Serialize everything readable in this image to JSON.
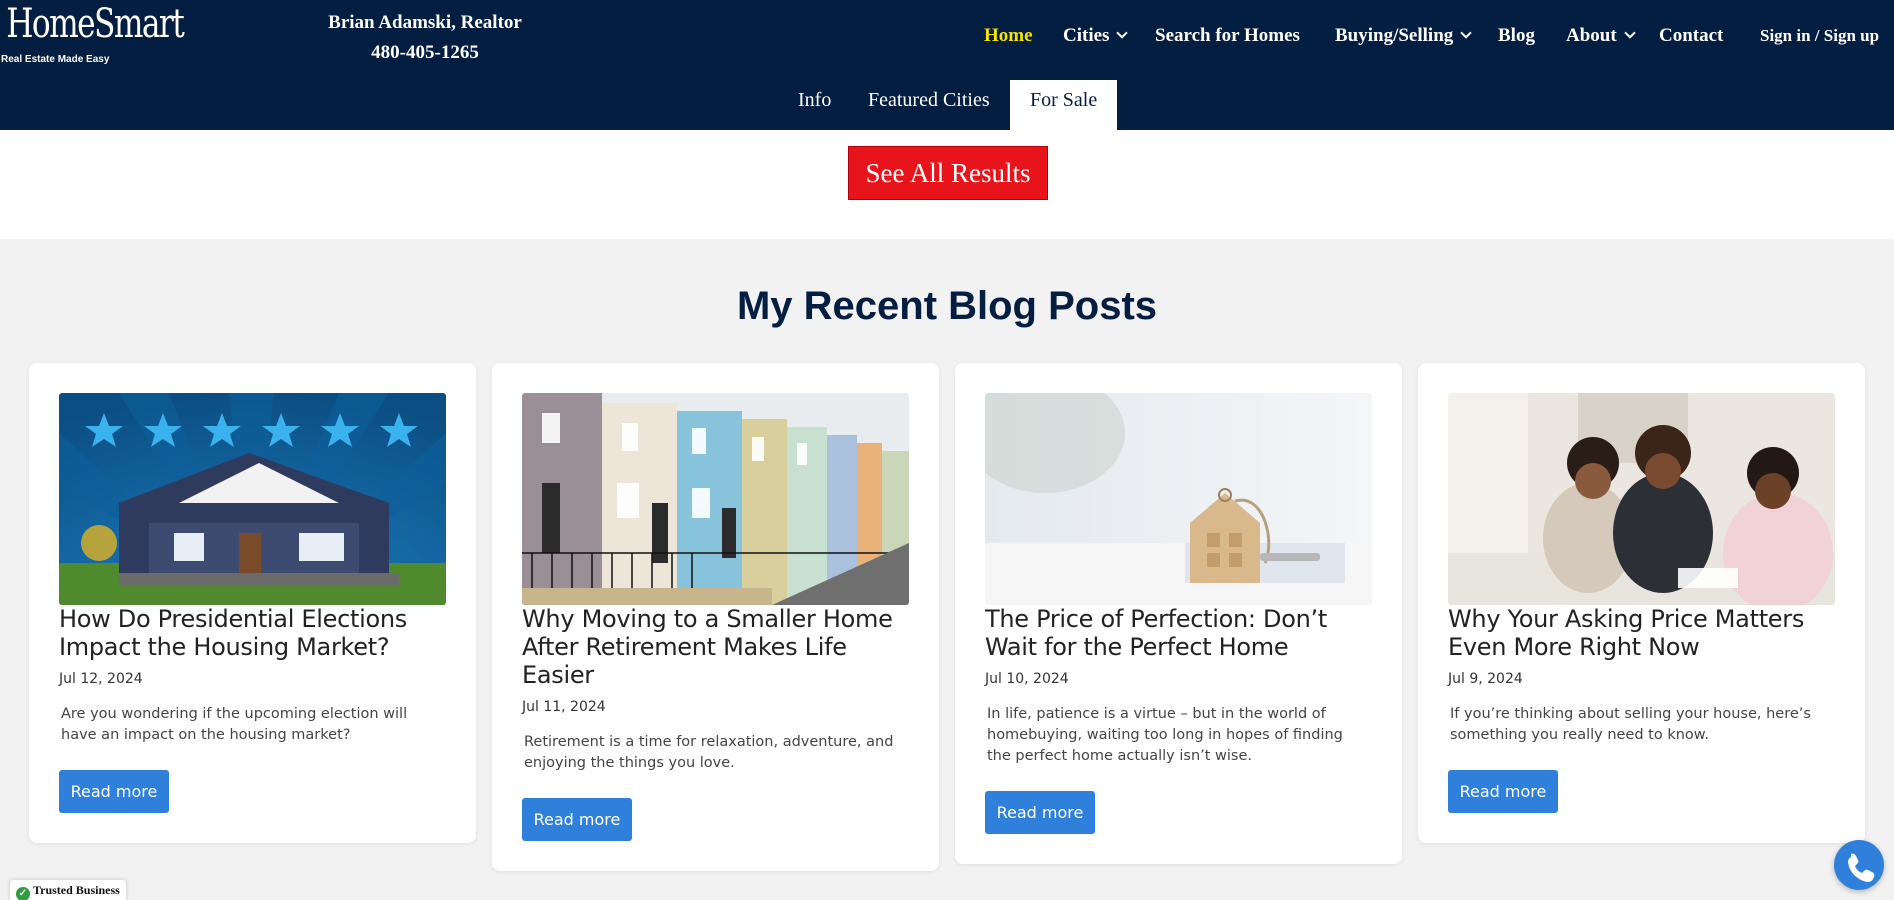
{
  "header": {
    "logo_text": "HomeSmart",
    "logo_tagline": "Real Estate Made Easy",
    "agent_name": "Brian Adamski, Realtor",
    "agent_phone": "480-405-1265"
  },
  "nav": {
    "items": [
      {
        "label": "Home",
        "active": true,
        "dropdown": false
      },
      {
        "label": "Cities",
        "active": false,
        "dropdown": true
      },
      {
        "label": "Search for Homes",
        "active": false,
        "dropdown": false
      },
      {
        "label": "Buying/Selling",
        "active": false,
        "dropdown": true
      },
      {
        "label": "Blog",
        "active": false,
        "dropdown": false
      },
      {
        "label": "About",
        "active": false,
        "dropdown": true
      },
      {
        "label": "Contact",
        "active": false,
        "dropdown": false
      }
    ],
    "signin_label": "Sign in / Sign up"
  },
  "subnav": {
    "items": [
      {
        "label": "Info",
        "active": false
      },
      {
        "label": "Featured Cities",
        "active": false
      },
      {
        "label": "For Sale",
        "active": true
      }
    ]
  },
  "results": {
    "see_all_label": "See All Results"
  },
  "blog": {
    "heading": "My Recent Blog Posts",
    "posts": [
      {
        "title": "How Do Presidential Elections Impact the Housing Market?",
        "date": "Jul 12, 2024",
        "excerpt": "Are you wondering if the upcoming election will have an impact on the housing market?",
        "button": "Read more",
        "image": "house-with-stars"
      },
      {
        "title": "Why Moving to a Smaller Home After Retirement Makes Life Easier",
        "date": "Jul 11, 2024",
        "excerpt": "Retirement is a time for relaxation, adventure, and enjoying the things you love.",
        "button": "Read more",
        "image": "colorful-townhouses"
      },
      {
        "title": "The Price of Perfection: Don’t Wait for the Perfect Home",
        "date": "Jul 10, 2024",
        "excerpt": "In life, patience is a virtue – but in the world of homebuying, waiting too long in hopes of finding the perfect home actually isn’t wise.",
        "button": "Read more",
        "image": "wooden-house-keychain"
      },
      {
        "title": "Why Your Asking Price Matters Even More Right Now",
        "date": "Jul 9, 2024",
        "excerpt": "If you’re thinking about selling your house, here’s something you really need to know.",
        "button": "Read more",
        "image": "agent-with-clients"
      }
    ]
  },
  "badges": {
    "trusted_label": "Trusted Business"
  },
  "colors": {
    "header_bg": "#041e42",
    "active_nav": "#f6e300",
    "cta_red": "#e8141c",
    "button_blue": "#2f80db"
  },
  "icons": [
    "chevron-down-icon",
    "check-circle-icon",
    "phone-icon"
  ]
}
